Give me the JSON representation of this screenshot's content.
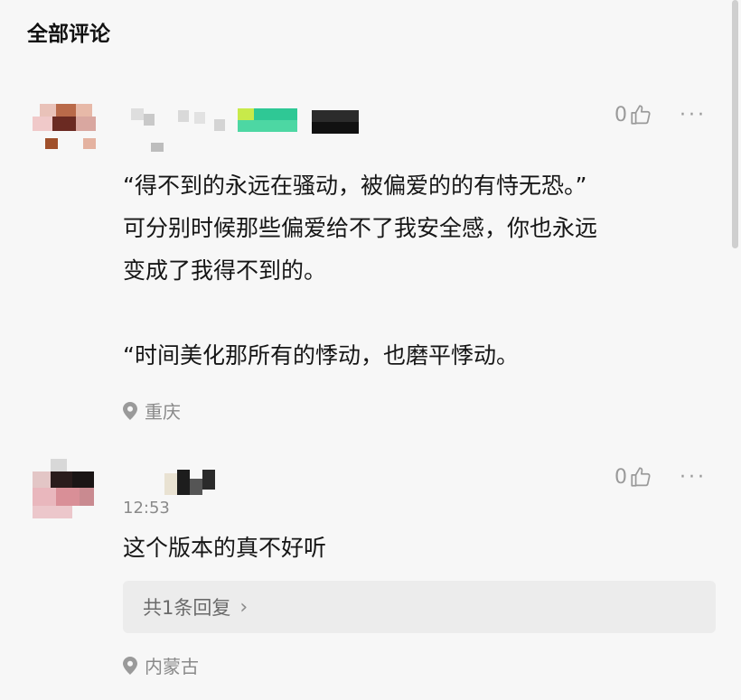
{
  "header": {
    "title": "全部评论"
  },
  "comments": [
    {
      "likes": "0",
      "more_label": "···",
      "content": "“得不到的永远在骚动，被偏爱的的有恃无恐。”\n可分别时候那些偏爱给不了我安全感，你也永远\n变成了我得不到的。\n\n“时间美化那所有的悸动，也磨平悸动。",
      "location": "重庆"
    },
    {
      "likes": "0",
      "more_label": "···",
      "timestamp": "12:53",
      "content": "这个版本的真不好听",
      "replies_label": "共1条回复",
      "replies_chevron": "›",
      "location": "内蒙古"
    }
  ],
  "colors": {
    "background": "#f7f7f7",
    "text": "#161616",
    "muted": "#8a8a8a",
    "reply_bg": "#ececec"
  },
  "icons": {
    "like": "thumbs-up-icon",
    "more": "more-dots-icon",
    "location": "location-pin-icon"
  }
}
